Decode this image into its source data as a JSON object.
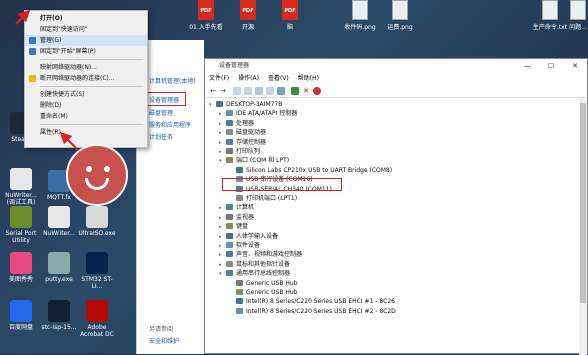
{
  "top_files": [
    {
      "label": "01.入手先看\n这里(必...",
      "kind": "pdf"
    },
    {
      "label": "开源\n说明...",
      "kind": "pdf"
    },
    {
      "label": "脑\n...",
      "kind": "pdf"
    },
    {
      "label": "收件码.png",
      "kind": "image"
    },
    {
      "label": "运费.png",
      "kind": "image"
    },
    {
      "label": "生产命令.txt",
      "kind": "text"
    },
    {
      "label": "问题...",
      "kind": "text"
    }
  ],
  "desktop_icons": [
    {
      "label": "Steam",
      "color": "#1b2838"
    },
    {
      "label": "NuWriter... (调试工具)",
      "color": "#e8e8e8"
    },
    {
      "label": "MQTT.fx",
      "color": "#3a6ea5"
    },
    {
      "label": "Serial Port Utility",
      "color": "#6a8f2a"
    },
    {
      "label": "NuWriter...",
      "color": "#e8e8e8"
    },
    {
      "label": "UltraISO.exe",
      "color": "#d9d9d9"
    },
    {
      "label": "电脑",
      "color": "#a5b9cf"
    },
    {
      "label": "美图秀秀",
      "color": "#e64980"
    },
    {
      "label": "putty.exe",
      "color": "#8aa"
    },
    {
      "label": "STM32 ST-LI...",
      "color": "#03234b"
    },
    {
      "label": "百度网盘",
      "color": "#2468f2"
    },
    {
      "label": "stc-isp-15...",
      "color": "#123"
    },
    {
      "label": "Adobe Acrobat DC",
      "color": "#b30b00"
    }
  ],
  "context_menu": {
    "items": [
      {
        "label": "打开(O)",
        "bold": true
      },
      {
        "label": "固定到\"快速访问\""
      },
      {
        "label": "管理(G)",
        "highlight": true
      },
      {
        "label": "固定到\"开始\"屏幕(P)"
      },
      {
        "sep": true
      },
      {
        "label": "映射网络驱动器(N)..."
      },
      {
        "label": "断开网络驱动器的连接(C)..."
      },
      {
        "sep": true
      },
      {
        "label": "创建快捷方式(S)"
      },
      {
        "label": "删除(D)"
      },
      {
        "label": "重命名(M)"
      },
      {
        "sep": true
      },
      {
        "label": "属性(R)"
      }
    ]
  },
  "computer_management": {
    "items": [
      "计算机管理(本地)",
      "设备管理器",
      "磁盘管理",
      "服务和应用程序",
      "计划任务",
      "高级系统设置"
    ],
    "footer": [
      "另请参阅",
      "安全和维护"
    ]
  },
  "device_manager": {
    "title": "设备管理器",
    "menu": [
      "文件(F)",
      "操作(A)",
      "查看(V)",
      "帮助(H)"
    ],
    "tree": [
      {
        "label": "DESKTOP-3AIM77B",
        "level": 0,
        "arrow": "open"
      },
      {
        "label": "IDE ATA/ATAPI 控制器",
        "level": 1,
        "arrow": "closed"
      },
      {
        "label": "处理器",
        "level": 1,
        "arrow": "closed"
      },
      {
        "label": "磁盘驱动器",
        "level": 1,
        "arrow": "closed"
      },
      {
        "label": "存储控制器",
        "level": 1,
        "arrow": "closed"
      },
      {
        "label": "打印队列",
        "level": 1,
        "arrow": "closed"
      },
      {
        "label": "端口 (COM 和 LPT)",
        "level": 1,
        "arrow": "open"
      },
      {
        "label": "Silicon Labs CP210x USB to UART Bridge (COM8)",
        "level": 2
      },
      {
        "label": "USB 串行设备 (COM16)",
        "level": 2,
        "highlight": true
      },
      {
        "label": "USB-SERIAL CH340 (COM11)",
        "level": 2
      },
      {
        "label": "打印机端口 (LPT1)",
        "level": 2
      },
      {
        "label": "计算机",
        "level": 1,
        "arrow": "closed"
      },
      {
        "label": "监视器",
        "level": 1,
        "arrow": "closed"
      },
      {
        "label": "键盘",
        "level": 1,
        "arrow": "closed"
      },
      {
        "label": "人体学输入设备",
        "level": 1,
        "arrow": "closed"
      },
      {
        "label": "软件设备",
        "level": 1,
        "arrow": "closed"
      },
      {
        "label": "声音、视频和游戏控制器",
        "level": 1,
        "arrow": "closed"
      },
      {
        "label": "鼠标和其他指针设备",
        "level": 1,
        "arrow": "closed"
      },
      {
        "label": "通用串行总线控制器",
        "level": 1,
        "arrow": "open"
      },
      {
        "label": "Generic USB Hub",
        "level": 2
      },
      {
        "label": "Generic USB Hub",
        "level": 2
      },
      {
        "label": "Intel(R) 8 Series/C220 Series USB EHCI #1 - 8C26",
        "level": 2
      },
      {
        "label": "Intel(R) 8 Series/C220 Series USB EHCI #2 - 8C2D",
        "level": 2
      }
    ]
  },
  "colors": {
    "highlight_box": "#e02020",
    "menu_highlight": "#cfe3f7",
    "smiley": "#c9514d"
  }
}
